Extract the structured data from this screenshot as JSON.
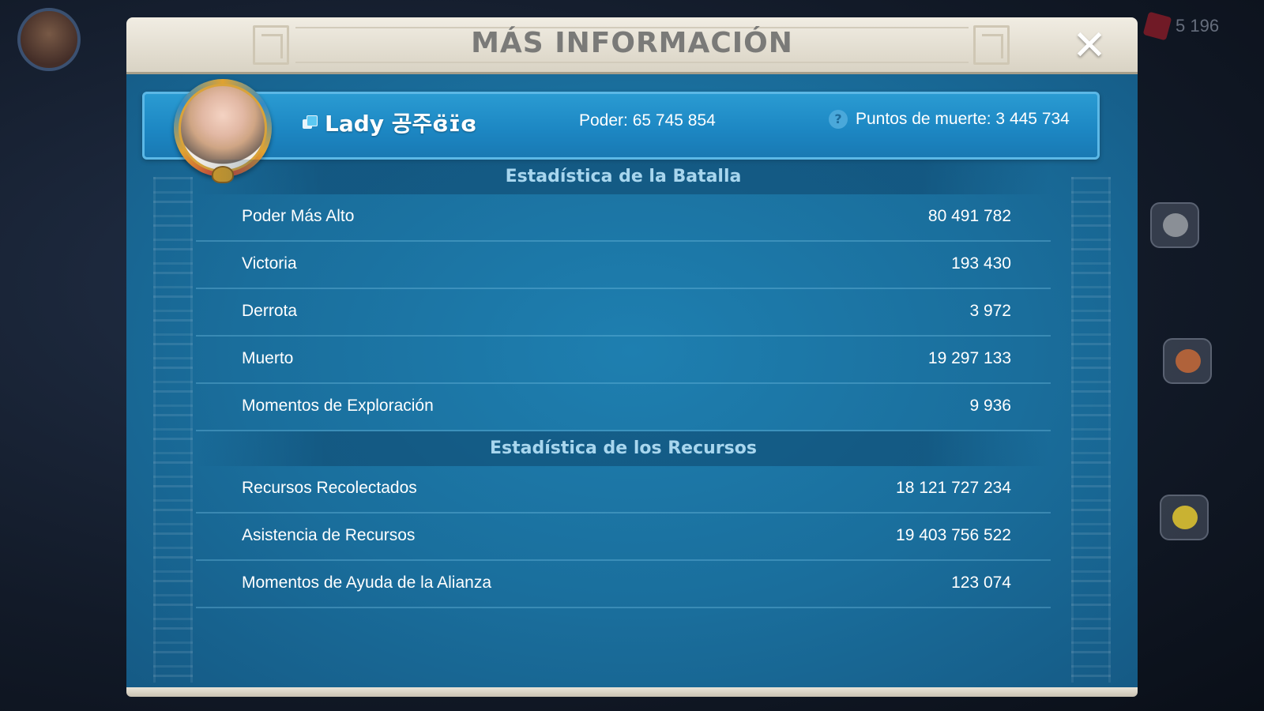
{
  "background": {
    "gem_count": "5 196",
    "side_buttons": [
      "stone-icon",
      "wood-icon",
      "corn-icon"
    ]
  },
  "modal": {
    "title": "MÁS INFORMACIÓN",
    "close_label": "✕"
  },
  "player": {
    "name": "Lady 공주ɞ̈ɪ̈ɞ",
    "power": "Poder: 65 745 854",
    "death_points": "Puntos de muerte: 3 445 734",
    "help_icon": "?"
  },
  "battle_stats": {
    "header": "Estadística de la Batalla",
    "rows": [
      {
        "label": "Poder Más Alto",
        "value": "80 491 782"
      },
      {
        "label": "Victoria",
        "value": "193 430"
      },
      {
        "label": "Derrota",
        "value": "3 972"
      },
      {
        "label": "Muerto",
        "value": "19 297 133"
      },
      {
        "label": "Momentos de Exploración",
        "value": "9 936"
      }
    ]
  },
  "resource_stats": {
    "header": "Estadística de los Recursos",
    "rows": [
      {
        "label": "Recursos Recolectados",
        "value": "18 121 727 234"
      },
      {
        "label": "Asistencia de Recursos",
        "value": "19 403 756 522"
      },
      {
        "label": "Momentos de Ayuda de la Alianza",
        "value": "123 074"
      }
    ]
  },
  "colors": {
    "panel_blue": "#1a6e9c",
    "banner_blue": "#1c86c2",
    "header_cream": "#e6e1d4",
    "section_text": "#a8d6ee"
  }
}
